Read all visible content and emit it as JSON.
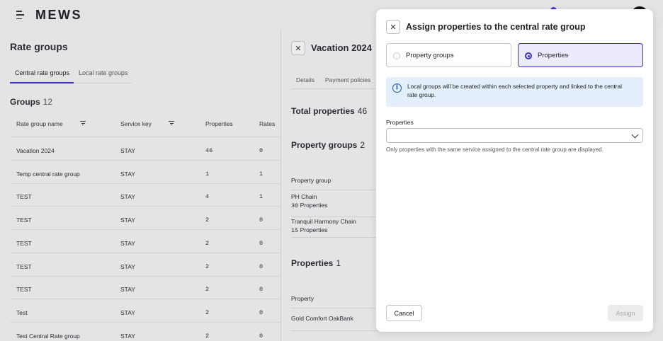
{
  "header": {
    "logo": "MEWS"
  },
  "rate_groups": {
    "title": "Rate groups",
    "tabs": [
      {
        "label": "Central rate groups",
        "active": true
      },
      {
        "label": "Local rate groups",
        "active": false
      }
    ],
    "groups_title": "Groups",
    "groups_count": "12",
    "columns": [
      "Rate group name",
      "Service key",
      "Properties",
      "Rates"
    ],
    "rows": [
      {
        "name": "Vacation 2024",
        "service": "STAY",
        "properties": "46",
        "rates": "0"
      },
      {
        "name": "Temp central rate group",
        "service": "STAY",
        "properties": "1",
        "rates": "1"
      },
      {
        "name": "TEST",
        "service": "STAY",
        "properties": "4",
        "rates": "1"
      },
      {
        "name": "TEST",
        "service": "STAY",
        "properties": "2",
        "rates": "0"
      },
      {
        "name": "TEST",
        "service": "STAY",
        "properties": "2",
        "rates": "0"
      },
      {
        "name": "TEST",
        "service": "STAY",
        "properties": "2",
        "rates": "0"
      },
      {
        "name": "TEST",
        "service": "STAY",
        "properties": "2",
        "rates": "0"
      },
      {
        "name": "Test",
        "service": "STAY",
        "properties": "2",
        "rates": "0"
      },
      {
        "name": "Test Central Rate group",
        "service": "STAY",
        "properties": "2",
        "rates": "0"
      }
    ]
  },
  "detail": {
    "title": "Vacation 2024",
    "tabs": [
      "Details",
      "Payment policies"
    ],
    "total_properties_label": "Total properties",
    "total_properties_count": "46",
    "property_groups_label": "Property groups",
    "property_groups_count": "2",
    "property_group_column": "Property group",
    "property_groups": [
      {
        "name": "PH Chain",
        "count": "30",
        "unit": "Properties"
      },
      {
        "name": "Tranquil Harmony Chain",
        "count": "15",
        "unit": "Properties"
      }
    ],
    "properties_label": "Properties",
    "properties_count": "1",
    "property_column": "Property",
    "properties": [
      "Gold Comfort OakBank"
    ]
  },
  "modal": {
    "title": "Assign properties to the central rate group",
    "options": [
      {
        "label": "Property groups",
        "selected": false
      },
      {
        "label": "Properties",
        "selected": true
      }
    ],
    "info_text": "Local groups will be created within each selected property and linked to the central rate group.",
    "field_label": "Properties",
    "select_value": "",
    "helper_text": "Only properties with the same service assigned to the central rate group are displayed.",
    "cancel_label": "Cancel",
    "assign_label": "Assign"
  },
  "colors": {
    "accent": "#3b30c8",
    "info_bg": "#e3effc",
    "info_icon": "#2456b8"
  }
}
